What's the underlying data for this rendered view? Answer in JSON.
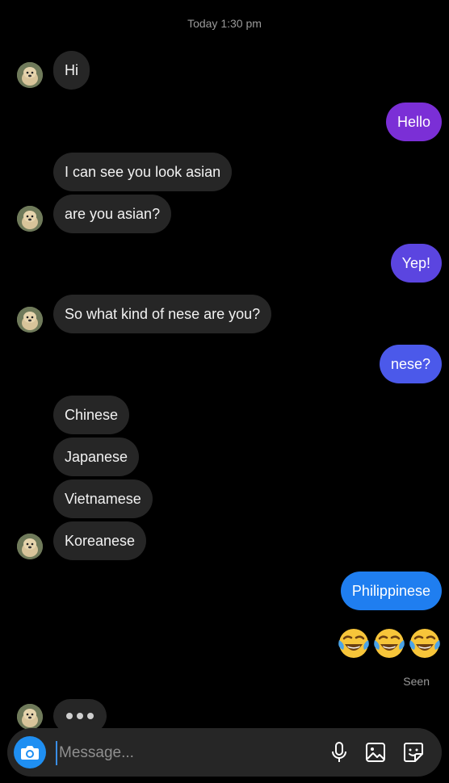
{
  "timestamp": "Today 1:30 pm",
  "messages": {
    "m1": "Hi",
    "m2": "Hello",
    "m3": "I can see you look asian",
    "m4": "are you asian?",
    "m5": "Yep!",
    "m6": "So what kind of nese are you?",
    "m7": "nese?",
    "m8": "Chinese",
    "m9": "Japanese",
    "m10": "Vietnamese",
    "m11": "Koreanese",
    "m12": "Philippinese"
  },
  "emoji_reaction": [
    "tears-of-joy",
    "tears-of-joy",
    "tears-of-joy"
  ],
  "seen_label": "Seen",
  "composer": {
    "placeholder": "Message...",
    "icons": [
      "camera-icon",
      "microphone-icon",
      "gallery-icon",
      "sticker-icon"
    ]
  },
  "colors": {
    "background": "#000000",
    "incoming_bubble": "#262626",
    "outgoing_violet": "#7b2fd6",
    "outgoing_indigo": "#5b45e0",
    "outgoing_royal": "#4b59ea",
    "outgoing_blue": "#1f7ef0",
    "camera_button": "#1f8ff2"
  }
}
